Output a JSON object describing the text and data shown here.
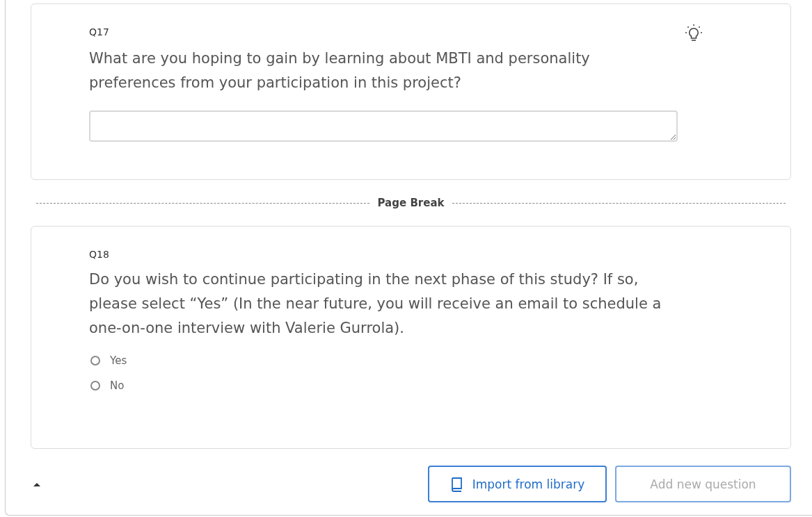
{
  "questions": [
    {
      "kind": "text_entry",
      "number": "Q17",
      "text": "What are you hoping to gain by learning about MBTI and personality preferences from your participation in this project?",
      "has_tip": true
    },
    {
      "kind": "page_break",
      "label": "Page Break"
    },
    {
      "kind": "multiple_choice",
      "number": "Q18",
      "text": "Do you wish to continue participating in the next phase of this study? If so, please select “Yes” (In the near future, you will receive an email to schedule a one-on-one interview with Valerie Gurrola).",
      "options": [
        {
          "label": "Yes",
          "selected": false
        },
        {
          "label": "No",
          "selected": false
        }
      ]
    }
  ],
  "footer": {
    "buttons": [
      {
        "label": "Import from library",
        "kind": "import",
        "disabled": false
      },
      {
        "label": "Add new question",
        "kind": "add",
        "disabled": true
      }
    ]
  }
}
